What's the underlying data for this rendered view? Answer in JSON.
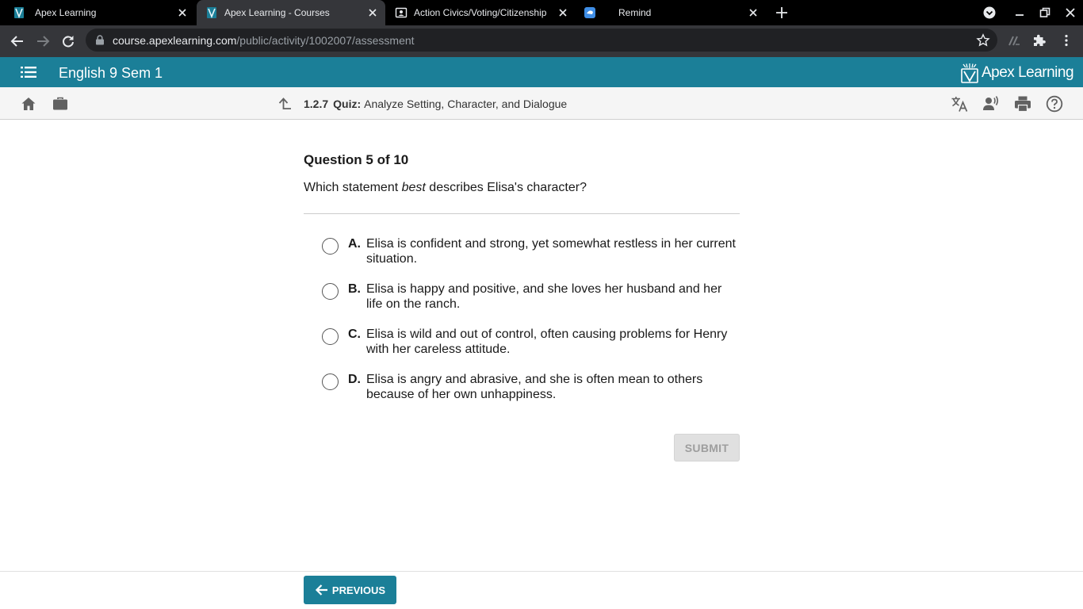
{
  "browser": {
    "tabs": [
      {
        "title": "Apex Learning",
        "active": false
      },
      {
        "title": "Apex Learning - Courses",
        "active": true
      },
      {
        "title": "Action Civics/Voting/Citizenship",
        "active": false
      },
      {
        "title": "Remind",
        "active": false
      }
    ],
    "url_host": "course.apexlearning.com",
    "url_path": "/public/activity/1002007/assessment"
  },
  "header": {
    "course_title": "English 9 Sem 1",
    "brand_name": "Apex Learning",
    "color": "#1b7f98"
  },
  "activity": {
    "number": "1.2.7",
    "kind": "Quiz:",
    "name": "Analyze Setting, Character, and Dialogue"
  },
  "question": {
    "counter": "Question 5 of 10",
    "prompt_before": "Which statement ",
    "prompt_emphasis": "best",
    "prompt_after": " describes Elisa's character?",
    "options": [
      {
        "letter": "A.",
        "text": "Elisa is confident and strong, yet somewhat restless in her current situation."
      },
      {
        "letter": "B.",
        "text": "Elisa is happy and positive, and she loves her husband and her life on the ranch."
      },
      {
        "letter": "C.",
        "text": "Elisa is wild and out of control, often causing problems for Henry with her careless attitude."
      },
      {
        "letter": "D.",
        "text": "Elisa is angry and abrasive, and she is often mean to others because of her own unhappiness."
      }
    ]
  },
  "buttons": {
    "submit": "SUBMIT",
    "previous": "PREVIOUS"
  },
  "icons": {
    "favicon_apex": "apex-favicon-icon",
    "favicon_classroom": "classroom-favicon-icon",
    "favicon_remind": "remind-favicon-icon",
    "translate": "translate-icon",
    "text_to_speech": "speaker-icon",
    "print": "print-icon",
    "help": "help-icon"
  }
}
